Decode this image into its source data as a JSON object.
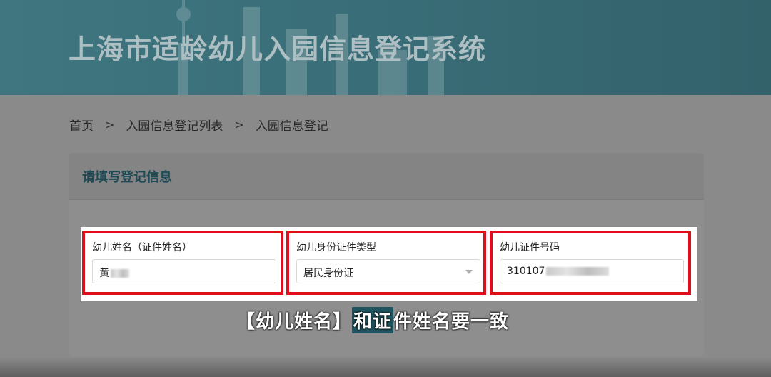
{
  "banner": {
    "title": "上海市适龄幼儿入园信息登记系统"
  },
  "breadcrumb": {
    "items": [
      "首页",
      "入园信息登记列表",
      "入园信息登记"
    ],
    "separator": ">"
  },
  "card": {
    "title": "请填写登记信息"
  },
  "fields": [
    {
      "label": "幼儿姓名（证件姓名）",
      "value": "黄"
    },
    {
      "label": "幼儿身份证件类型",
      "value": "居民身份证"
    },
    {
      "label": "幼儿证件号码",
      "value": "310107"
    }
  ],
  "caption": {
    "part1": "【幼儿姓名】",
    "part2": "和证",
    "part3": "件姓名要一致"
  },
  "colors": {
    "highlight_border": "#e00d1a",
    "banner": "#3a6f79",
    "title_text": "#1f4a55"
  }
}
